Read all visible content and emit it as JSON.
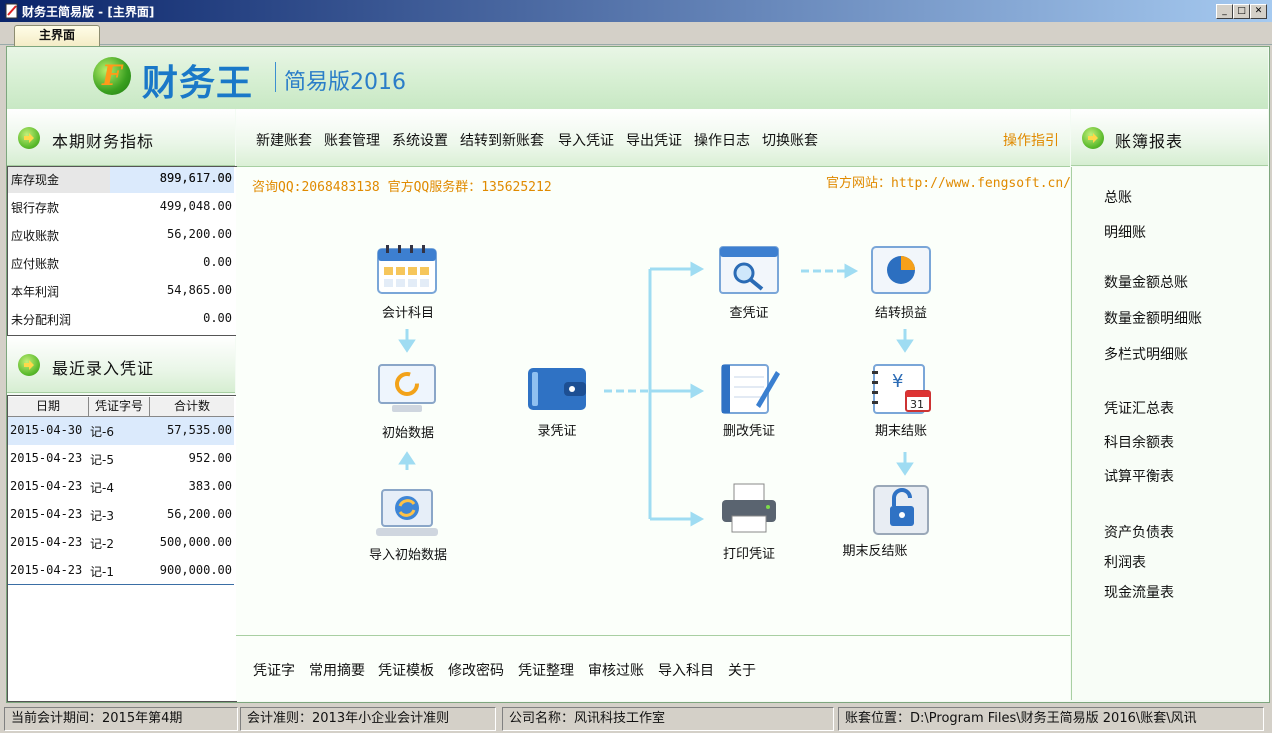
{
  "window": {
    "title": "财务王简易版 - [主界面]",
    "controls": {
      "minimize": "_",
      "restore": "□",
      "close": "✕"
    }
  },
  "tabs": [
    {
      "label": "主界面",
      "active": true
    }
  ],
  "header": {
    "logo_letter": "F",
    "brand": "财务王",
    "edition": "简易版2016"
  },
  "left": {
    "indicators_title": "本期财务指标",
    "indicators": [
      {
        "label": "库存现金",
        "value": "899,617.00"
      },
      {
        "label": "银行存款",
        "value": "499,048.00"
      },
      {
        "label": "应收账款",
        "value": "56,200.00"
      },
      {
        "label": "应付账款",
        "value": "0.00"
      },
      {
        "label": "本年利润",
        "value": "54,865.00"
      },
      {
        "label": "未分配利润",
        "value": "0.00"
      }
    ],
    "vouchers_title": "最近录入凭证",
    "voucher_columns": [
      "日期",
      "凭证字号",
      "合计数"
    ],
    "vouchers": [
      {
        "date": "2015-04-30",
        "no": "记-6",
        "amount": "57,535.00"
      },
      {
        "date": "2015-04-23",
        "no": "记-5",
        "amount": "952.00"
      },
      {
        "date": "2015-04-23",
        "no": "记-4",
        "amount": "383.00"
      },
      {
        "date": "2015-04-23",
        "no": "记-3",
        "amount": "56,200.00"
      },
      {
        "date": "2015-04-23",
        "no": "记-2",
        "amount": "500,000.00"
      },
      {
        "date": "2015-04-23",
        "no": "记-1",
        "amount": "900,000.00"
      }
    ]
  },
  "menu": {
    "items": [
      "新建账套",
      "账套管理",
      "系统设置",
      "结转到新账套",
      "导入凭证",
      "导出凭证",
      "操作日志",
      "切换账套"
    ],
    "guide": "操作指引"
  },
  "center": {
    "qq_info": "咨询QQ:2068483138 官方QQ服务群：135625212",
    "website": "官方网站：http://www.fengsoft.cn/",
    "flow": {
      "accounts": "会计科目",
      "init_data": "初始数据",
      "import_init": "导入初始数据",
      "record": "录凭证",
      "query": "查凭证",
      "edit": "删改凭证",
      "print": "打印凭证",
      "transfer": "结转损益",
      "close": "期末结账",
      "unclose": "期末反结账"
    },
    "calendar_day": "31",
    "currency_symbol": "¥"
  },
  "bottom_links": [
    "凭证字",
    "常用摘要",
    "凭证模板",
    "修改密码",
    "凭证整理",
    "审核过账",
    "导入科目",
    "关于"
  ],
  "right": {
    "title": "账簿报表",
    "links": [
      "总账",
      "明细账",
      "数量金额总账",
      "数量金额明细账",
      "多栏式明细账",
      "凭证汇总表",
      "科目余额表",
      "试算平衡表",
      "资产负债表",
      "利润表",
      "现金流量表"
    ]
  },
  "status": {
    "period": "当前会计期间：2015年第4期",
    "standard": "会计准则：2013年小企业会计准则",
    "company": "公司名称：风讯科技工作室",
    "location": "账套位置：D:\\Program Files\\财务王简易版 2016\\账套\\风讯"
  },
  "colors": {
    "accent_orange": "#e08a00",
    "brand_blue": "#1a78c8",
    "selected_row": "#dbeafc"
  }
}
